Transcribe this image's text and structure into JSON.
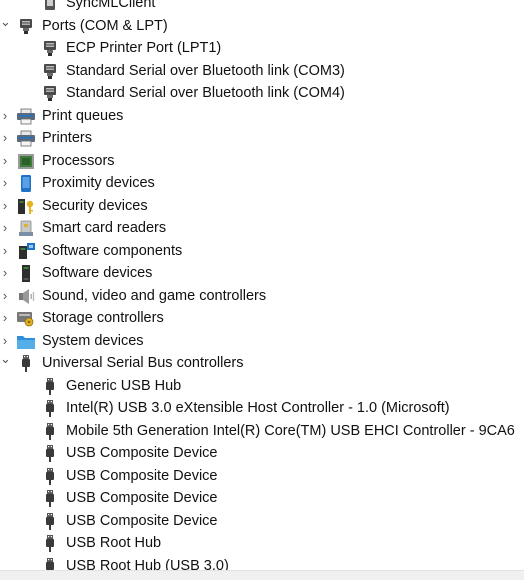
{
  "tree": [
    {
      "label": "SyncMLClient",
      "level": 1,
      "icon": "sync-device-icon",
      "expander": ""
    },
    {
      "label": "Ports (COM & LPT)",
      "level": 0,
      "icon": "port-icon",
      "expander": "expanded"
    },
    {
      "label": "ECP Printer Port (LPT1)",
      "level": 1,
      "icon": "port-icon",
      "expander": ""
    },
    {
      "label": "Standard Serial over Bluetooth link (COM3)",
      "level": 1,
      "icon": "port-icon",
      "expander": ""
    },
    {
      "label": "Standard Serial over Bluetooth link (COM4)",
      "level": 1,
      "icon": "port-icon",
      "expander": ""
    },
    {
      "label": "Print queues",
      "level": 0,
      "icon": "printer-icon",
      "expander": "collapsed"
    },
    {
      "label": "Printers",
      "level": 0,
      "icon": "printer-icon",
      "expander": "collapsed"
    },
    {
      "label": "Processors",
      "level": 0,
      "icon": "processor-icon",
      "expander": "collapsed"
    },
    {
      "label": "Proximity devices",
      "level": 0,
      "icon": "proximity-device-icon",
      "expander": "collapsed"
    },
    {
      "label": "Security devices",
      "level": 0,
      "icon": "security-device-icon",
      "expander": "collapsed"
    },
    {
      "label": "Smart card readers",
      "level": 0,
      "icon": "smart-card-reader-icon",
      "expander": "collapsed"
    },
    {
      "label": "Software components",
      "level": 0,
      "icon": "software-component-icon",
      "expander": "collapsed"
    },
    {
      "label": "Software devices",
      "level": 0,
      "icon": "software-device-icon",
      "expander": "collapsed"
    },
    {
      "label": "Sound, video and game controllers",
      "level": 0,
      "icon": "speaker-icon",
      "expander": "collapsed"
    },
    {
      "label": "Storage controllers",
      "level": 0,
      "icon": "storage-controller-icon",
      "expander": "collapsed"
    },
    {
      "label": "System devices",
      "level": 0,
      "icon": "system-folder-icon",
      "expander": "collapsed"
    },
    {
      "label": "Universal Serial Bus controllers",
      "level": 0,
      "icon": "usb-plug-icon",
      "expander": "expanded"
    },
    {
      "label": "Generic USB Hub",
      "level": 1,
      "icon": "usb-plug-icon",
      "expander": ""
    },
    {
      "label": "Intel(R) USB 3.0 eXtensible Host Controller - 1.0 (Microsoft)",
      "level": 1,
      "icon": "usb-plug-icon",
      "expander": ""
    },
    {
      "label": "Mobile 5th Generation Intel(R) Core(TM) USB EHCI Controller - 9CA6",
      "level": 1,
      "icon": "usb-plug-icon",
      "expander": ""
    },
    {
      "label": "USB Composite Device",
      "level": 1,
      "icon": "usb-plug-icon",
      "expander": ""
    },
    {
      "label": "USB Composite Device",
      "level": 1,
      "icon": "usb-plug-icon",
      "expander": ""
    },
    {
      "label": "USB Composite Device",
      "level": 1,
      "icon": "usb-plug-icon",
      "expander": ""
    },
    {
      "label": "USB Composite Device",
      "level": 1,
      "icon": "usb-plug-icon",
      "expander": ""
    },
    {
      "label": "USB Root Hub",
      "level": 1,
      "icon": "usb-plug-icon",
      "expander": ""
    },
    {
      "label": "USB Root Hub (USB 3.0)",
      "level": 1,
      "icon": "usb-plug-icon",
      "expander": ""
    }
  ],
  "colors": {
    "text": "#111111",
    "caret": "#555555",
    "icon_dark": "#3a3a3a",
    "icon_blue": "#1e73c8",
    "icon_green": "#3c7d3a",
    "icon_yellow": "#e6b422"
  }
}
